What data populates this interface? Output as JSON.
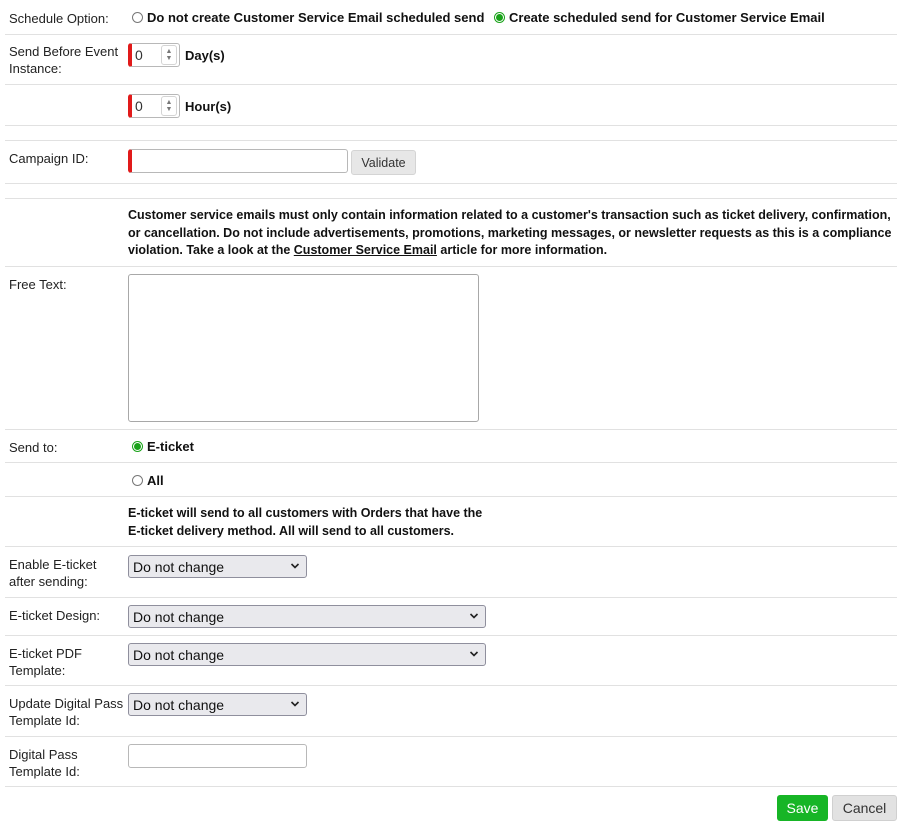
{
  "schedule": {
    "label": "Schedule Option:",
    "options": [
      {
        "label": "Do not create Customer Service Email scheduled send",
        "selected": false
      },
      {
        "label": "Create scheduled send for Customer Service Email",
        "selected": true
      }
    ]
  },
  "send_before": {
    "label": "Send Before Event Instance:",
    "days_value": "0",
    "days_unit": "Day(s)",
    "hours_value": "0",
    "hours_unit": "Hour(s)"
  },
  "campaign": {
    "label": "Campaign ID:",
    "value": "",
    "validate_label": "Validate"
  },
  "notice": {
    "before_link": "Customer service emails must only contain information related to a customer's transaction such as ticket delivery, confirmation, or cancellation. Do not include advertisements, promotions, marketing messages, or newsletter requests as this is a compliance violation. Take a look at the ",
    "link_text": "Customer Service Email",
    "after_link": " article for more information."
  },
  "free_text": {
    "label": "Free Text:",
    "value": ""
  },
  "send_to": {
    "label": "Send to:",
    "options": [
      {
        "label": "E-ticket",
        "selected": true
      },
      {
        "label": "All",
        "selected": false
      }
    ],
    "help": "E-ticket will send to all customers with Orders that have the E-ticket delivery method. All will send to all customers."
  },
  "enable_eticket": {
    "label": "Enable E-ticket after sending:",
    "value": "Do not change"
  },
  "eticket_design": {
    "label": "E-ticket Design:",
    "value": "Do not change"
  },
  "eticket_pdf": {
    "label": "E-ticket PDF Template:",
    "value": "Do not change"
  },
  "update_digital_pass": {
    "label": "Update Digital Pass Template Id:",
    "value": "Do not change"
  },
  "digital_pass_id": {
    "label": "Digital Pass Template Id:",
    "value": ""
  },
  "actions": {
    "save_label": "Save",
    "cancel_label": "Cancel"
  },
  "colors": {
    "accent_green": "#17b526",
    "required_red": "#e11a1a"
  }
}
